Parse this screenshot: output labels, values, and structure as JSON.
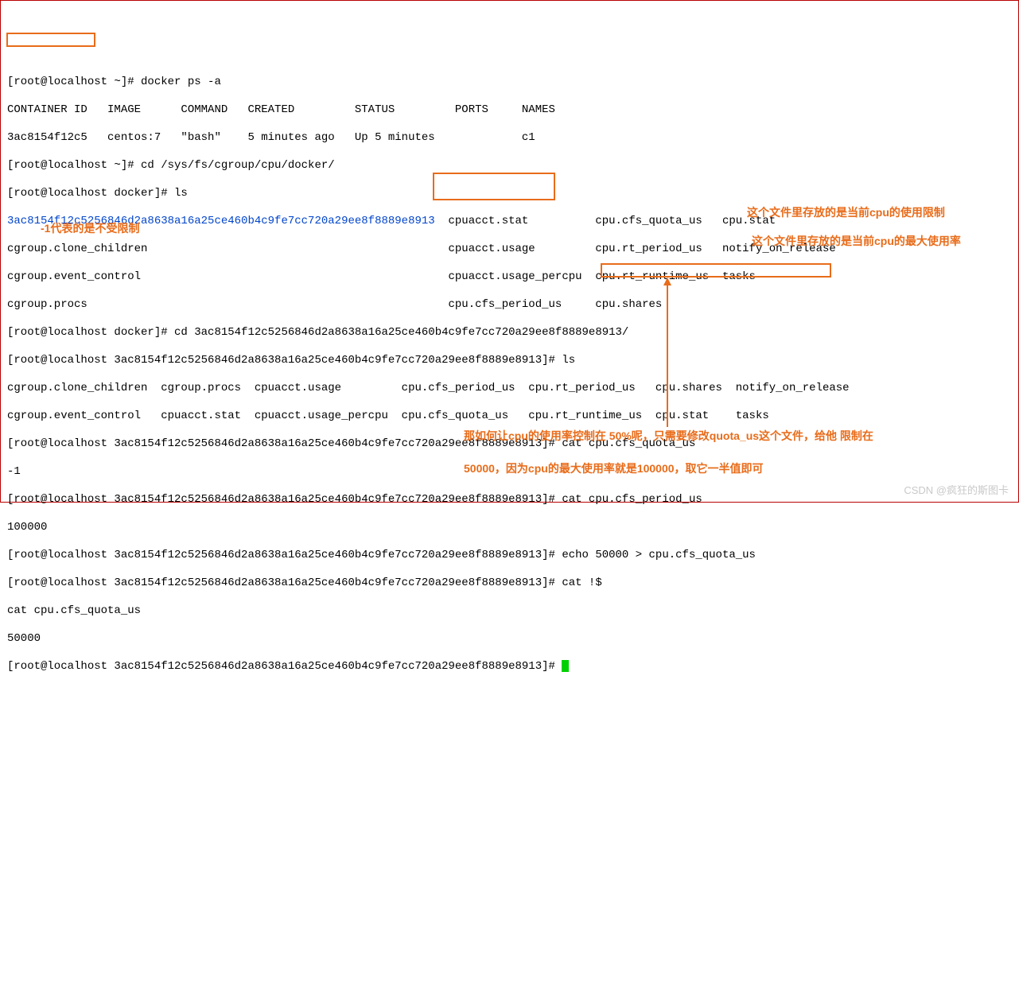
{
  "lines": {
    "l1": "[root@localhost ~]# docker ps -a",
    "l2": "CONTAINER ID   IMAGE      COMMAND   CREATED         STATUS         PORTS     NAMES",
    "l3": "3ac8154f12c5   centos:7   \"bash\"    5 minutes ago   Up 5 minutes             c1",
    "l4": "[root@localhost ~]# cd /sys/fs/cgroup/cpu/docker/",
    "l5": "[root@localhost docker]# ls",
    "l6a": "3ac8154f12c5256846d2a8638a16a25ce460b4c9fe7cc720a29ee8f8889e8913",
    "l6b": "  cpuacct.stat          cpu.cfs_quota_us   cpu.stat",
    "l7": "cgroup.clone_children                                             cpuacct.usage         cpu.rt_period_us   notify_on_release",
    "l8": "cgroup.event_control                                              cpuacct.usage_percpu  cpu.rt_runtime_us  tasks",
    "l9": "cgroup.procs                                                      cpu.cfs_period_us     cpu.shares",
    "l10": "[root@localhost docker]# cd 3ac8154f12c5256846d2a8638a16a25ce460b4c9fe7cc720a29ee8f8889e8913/",
    "l11": "[root@localhost 3ac8154f12c5256846d2a8638a16a25ce460b4c9fe7cc720a29ee8f8889e8913]# ls",
    "l12": "cgroup.clone_children  cgroup.procs  cpuacct.usage         cpu.cfs_period_us  cpu.rt_period_us   cpu.shares  notify_on_release",
    "l13": "cgroup.event_control   cpuacct.stat  cpuacct.usage_percpu  cpu.cfs_quota_us   cpu.rt_runtime_us  cpu.stat    tasks",
    "l14": "[root@localhost 3ac8154f12c5256846d2a8638a16a25ce460b4c9fe7cc720a29ee8f8889e8913]# cat cpu.cfs_quota_us",
    "l15": "-1",
    "l16": "[root@localhost 3ac8154f12c5256846d2a8638a16a25ce460b4c9fe7cc720a29ee8f8889e8913]# cat cpu.cfs_period_us",
    "l17": "100000",
    "l18": "[root@localhost 3ac8154f12c5256846d2a8638a16a25ce460b4c9fe7cc720a29ee8f8889e8913]# echo 50000 > cpu.cfs_quota_us",
    "l19": "[root@localhost 3ac8154f12c5256846d2a8638a16a25ce460b4c9fe7cc720a29ee8f8889e8913]# cat !$",
    "l20": "cat cpu.cfs_quota_us",
    "l21": "50000",
    "l22": "[root@localhost 3ac8154f12c5256846d2a8638a16a25ce460b4c9fe7cc720a29ee8f8889e8913]# "
  },
  "annotations": {
    "a1": "-1代表的是不受限制",
    "a2": "这个文件里存放的是当前cpu的使用限制",
    "a3": "这个文件里存放的是当前cpu的最大使用率",
    "a4": "那如何让cpu的使用率控制在 50%呢，只需要修改quota_us这个文件，给他   限制在",
    "a5": "50000，因为cpu的最大使用率就是100000，取它一半值即可"
  },
  "watermark": "CSDN @疯狂的斯图卡"
}
